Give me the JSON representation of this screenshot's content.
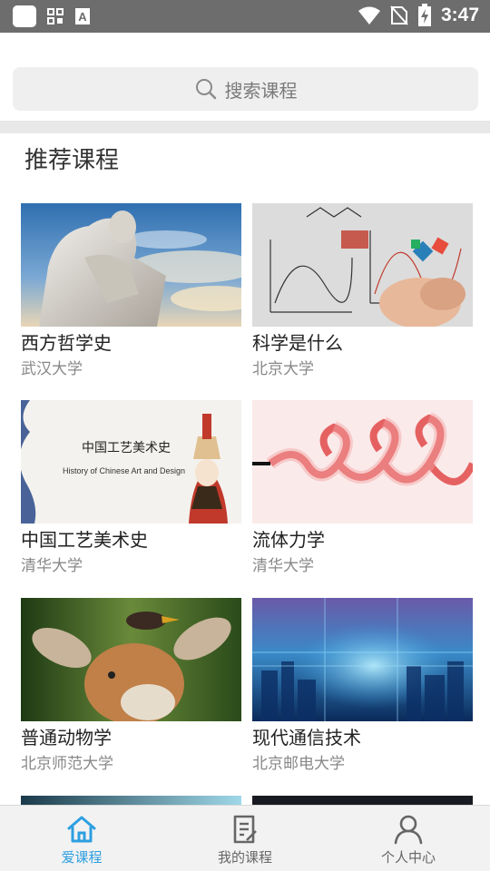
{
  "status_bar": {
    "time": "3:47"
  },
  "search": {
    "placeholder": "搜索课程"
  },
  "section_title": "推荐课程",
  "courses": [
    {
      "name": "西方哲学史",
      "university": "武汉大学"
    },
    {
      "name": "科学是什么",
      "university": "北京大学"
    },
    {
      "name": "中国工艺美术史",
      "university": "清华大学",
      "thumb_title": "中国工艺美术史",
      "thumb_subtitle": "History of Chinese Art and Design"
    },
    {
      "name": "流体力学",
      "university": "清华大学"
    },
    {
      "name": "普通动物学",
      "university": "北京师范大学"
    },
    {
      "name": "现代通信技术",
      "university": "北京邮电大学"
    }
  ],
  "tabs": [
    {
      "label": "爱课程",
      "icon": "home-icon",
      "active": true
    },
    {
      "label": "我的课程",
      "icon": "document-icon",
      "active": false
    },
    {
      "label": "个人中心",
      "icon": "person-icon",
      "active": false
    }
  ],
  "colors": {
    "active_tab": "#2d9fe0",
    "inactive_tab": "#666666",
    "status_bar": "#6d6d6d"
  }
}
